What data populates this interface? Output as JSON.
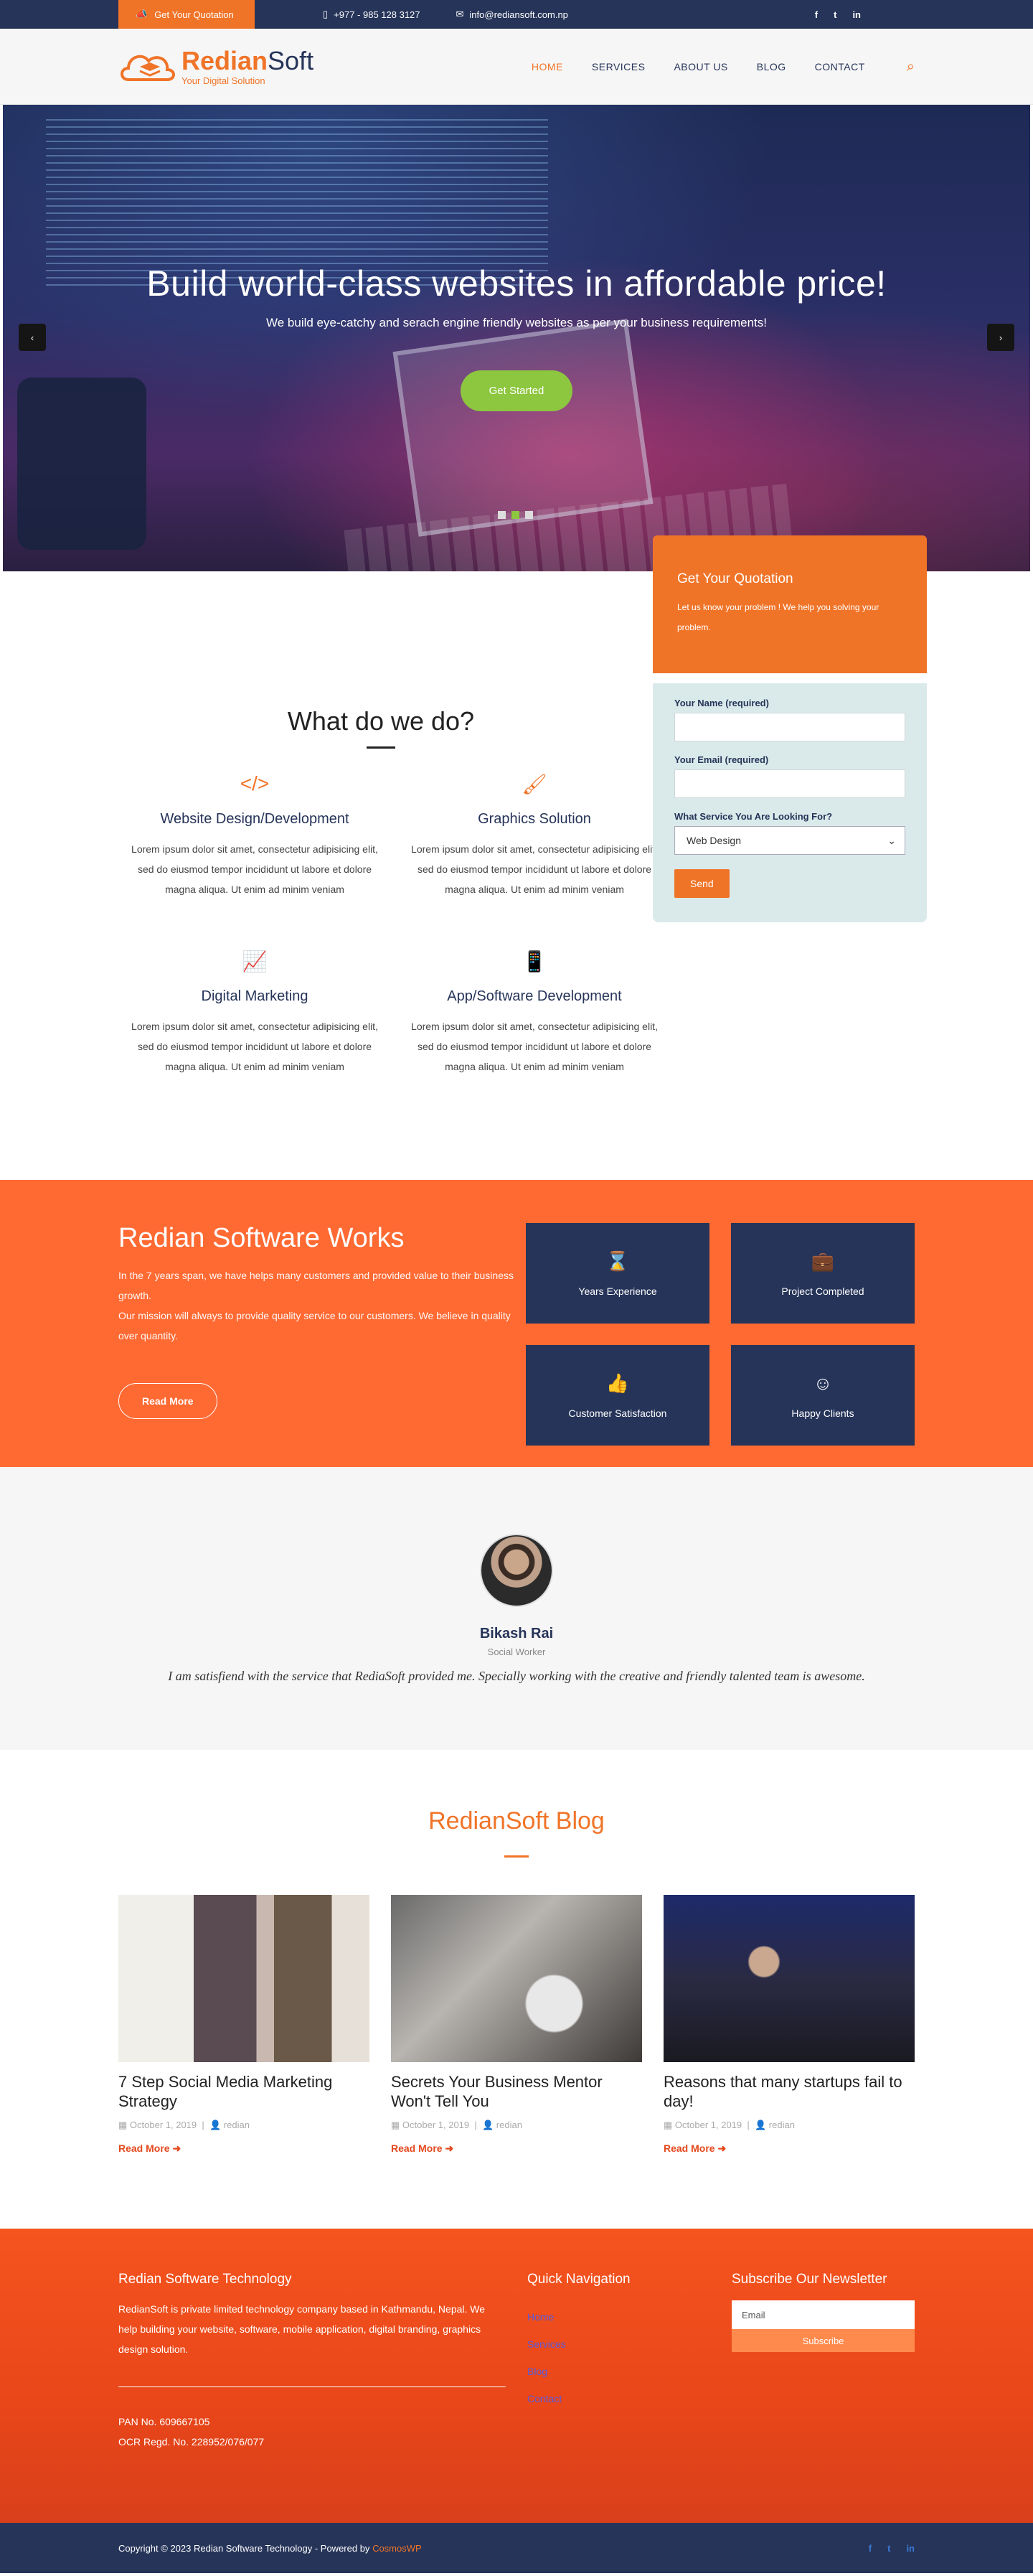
{
  "topbar": {
    "quote_label": "Get Your Quotation",
    "phone": "+977 - 985 128 3127",
    "email": "info@rediansoft.com.np",
    "social": [
      "f",
      "t",
      "in"
    ]
  },
  "header": {
    "logo_main": "Redian",
    "logo_accent": "Soft",
    "logo_tagline": "Your Digital Solution",
    "nav": [
      "HOME",
      "SERVICES",
      "ABOUT US",
      "BLOG",
      "CONTACT"
    ]
  },
  "hero": {
    "title": "Build world-class websites in affordable price!",
    "subtitle": "We build eye-catchy and serach engine friendly websites as per your business requirements!",
    "button": "Get Started",
    "prev": "‹",
    "next": "›"
  },
  "quote": {
    "title": "Get Your Quotation",
    "text": "Let us know your problem ! We help you solving your problem.",
    "name_label": "Your Name (required)",
    "email_label": "Your Email (required)",
    "service_label": "What Service You Are Looking For?",
    "service_value": "Web Design",
    "send": "Send"
  },
  "services": {
    "heading": "What do we do?",
    "items": [
      {
        "icon": "code-icon",
        "glyph": "</>",
        "title": "Website Design/Development",
        "text": "Lorem ipsum dolor sit amet, consectetur adipisicing elit, sed do eiusmod tempor incididunt ut labore et dolore magna aliqua. Ut enim ad minim veniam"
      },
      {
        "icon": "brush-icon",
        "glyph": "🖌",
        "title": "Graphics Solution",
        "text": "Lorem ipsum dolor sit amet, consectetur adipisicing elit, sed do eiusmod tempor incididunt ut labore et dolore magna aliqua. Ut enim ad minim veniam"
      },
      {
        "icon": "chart-line-icon",
        "glyph": "📈",
        "title": "Digital Marketing",
        "text": "Lorem ipsum dolor sit amet, consectetur adipisicing elit, sed do eiusmod tempor incididunt ut labore et dolore magna aliqua. Ut enim ad minim veniam"
      },
      {
        "icon": "mobile-icon",
        "glyph": "📱",
        "title": "App/Software Development",
        "text": "Lorem ipsum dolor sit amet, consectetur adipisicing elit, sed do eiusmod tempor incididunt ut labore et dolore magna aliqua. Ut enim ad minim veniam"
      }
    ]
  },
  "works": {
    "title": "Redian Software Works",
    "text1": "In the 7 years span, we have helps many customers and provided value to their business growth.",
    "text2": "Our mission will always to provide quality service to our customers. We believe in quality over quantity.",
    "button": "Read More",
    "stats": [
      {
        "icon": "hourglass-icon",
        "glyph": "⌛",
        "label": "Years Experience"
      },
      {
        "icon": "briefcase-icon",
        "glyph": "💼",
        "label": "Project Completed"
      },
      {
        "icon": "thumbs-up-icon",
        "glyph": "👍",
        "label": "Customer Satisfaction"
      },
      {
        "icon": "smile-icon",
        "glyph": "☺",
        "label": "Happy Clients"
      }
    ]
  },
  "testimonial": {
    "name": "Bikash Rai",
    "role": "Social Worker",
    "quote": "I am satisfiend with the service that RediaSoft provided me. Specially working with the creative and friendly talented team is awesome."
  },
  "blog": {
    "heading": "RedianSoft Blog",
    "posts": [
      {
        "title": "7 Step Social Media Marketing Strategy",
        "date": "October 1, 2019",
        "author": "redian",
        "more": "Read More"
      },
      {
        "title": "Secrets Your Business Mentor Won't Tell You",
        "date": "October 1, 2019",
        "author": "redian",
        "more": "Read More"
      },
      {
        "title": "Reasons that many startups fail to day!",
        "date": "October 1, 2019",
        "author": "redian",
        "more": "Read More"
      }
    ]
  },
  "footer": {
    "about_title": "Redian Software Technology",
    "about_text": "RedianSoft is private limited technology company based in Kathmandu, Nepal. We help building your website, software, mobile application, digital branding, graphics design solution.",
    "pan": "PAN No. 609667105",
    "ocr": "OCR Regd. No. 228952/076/077",
    "nav_title": "Quick Navigation",
    "nav_links": [
      "Home",
      "Services",
      "Blog",
      "Contact"
    ],
    "newsletter_title": "Subscribe Our Newsletter",
    "email_placeholder": "Email",
    "subscribe": "Subscribe"
  },
  "copyright": {
    "text": "Copyright © 2023 Redian Software Technology - Powered by",
    "powered": "CosmosWP",
    "social": [
      "f",
      "t",
      "in"
    ]
  },
  "colors": {
    "brand_orange": "#f07428",
    "navy": "#263459",
    "green": "#8dc63f"
  }
}
